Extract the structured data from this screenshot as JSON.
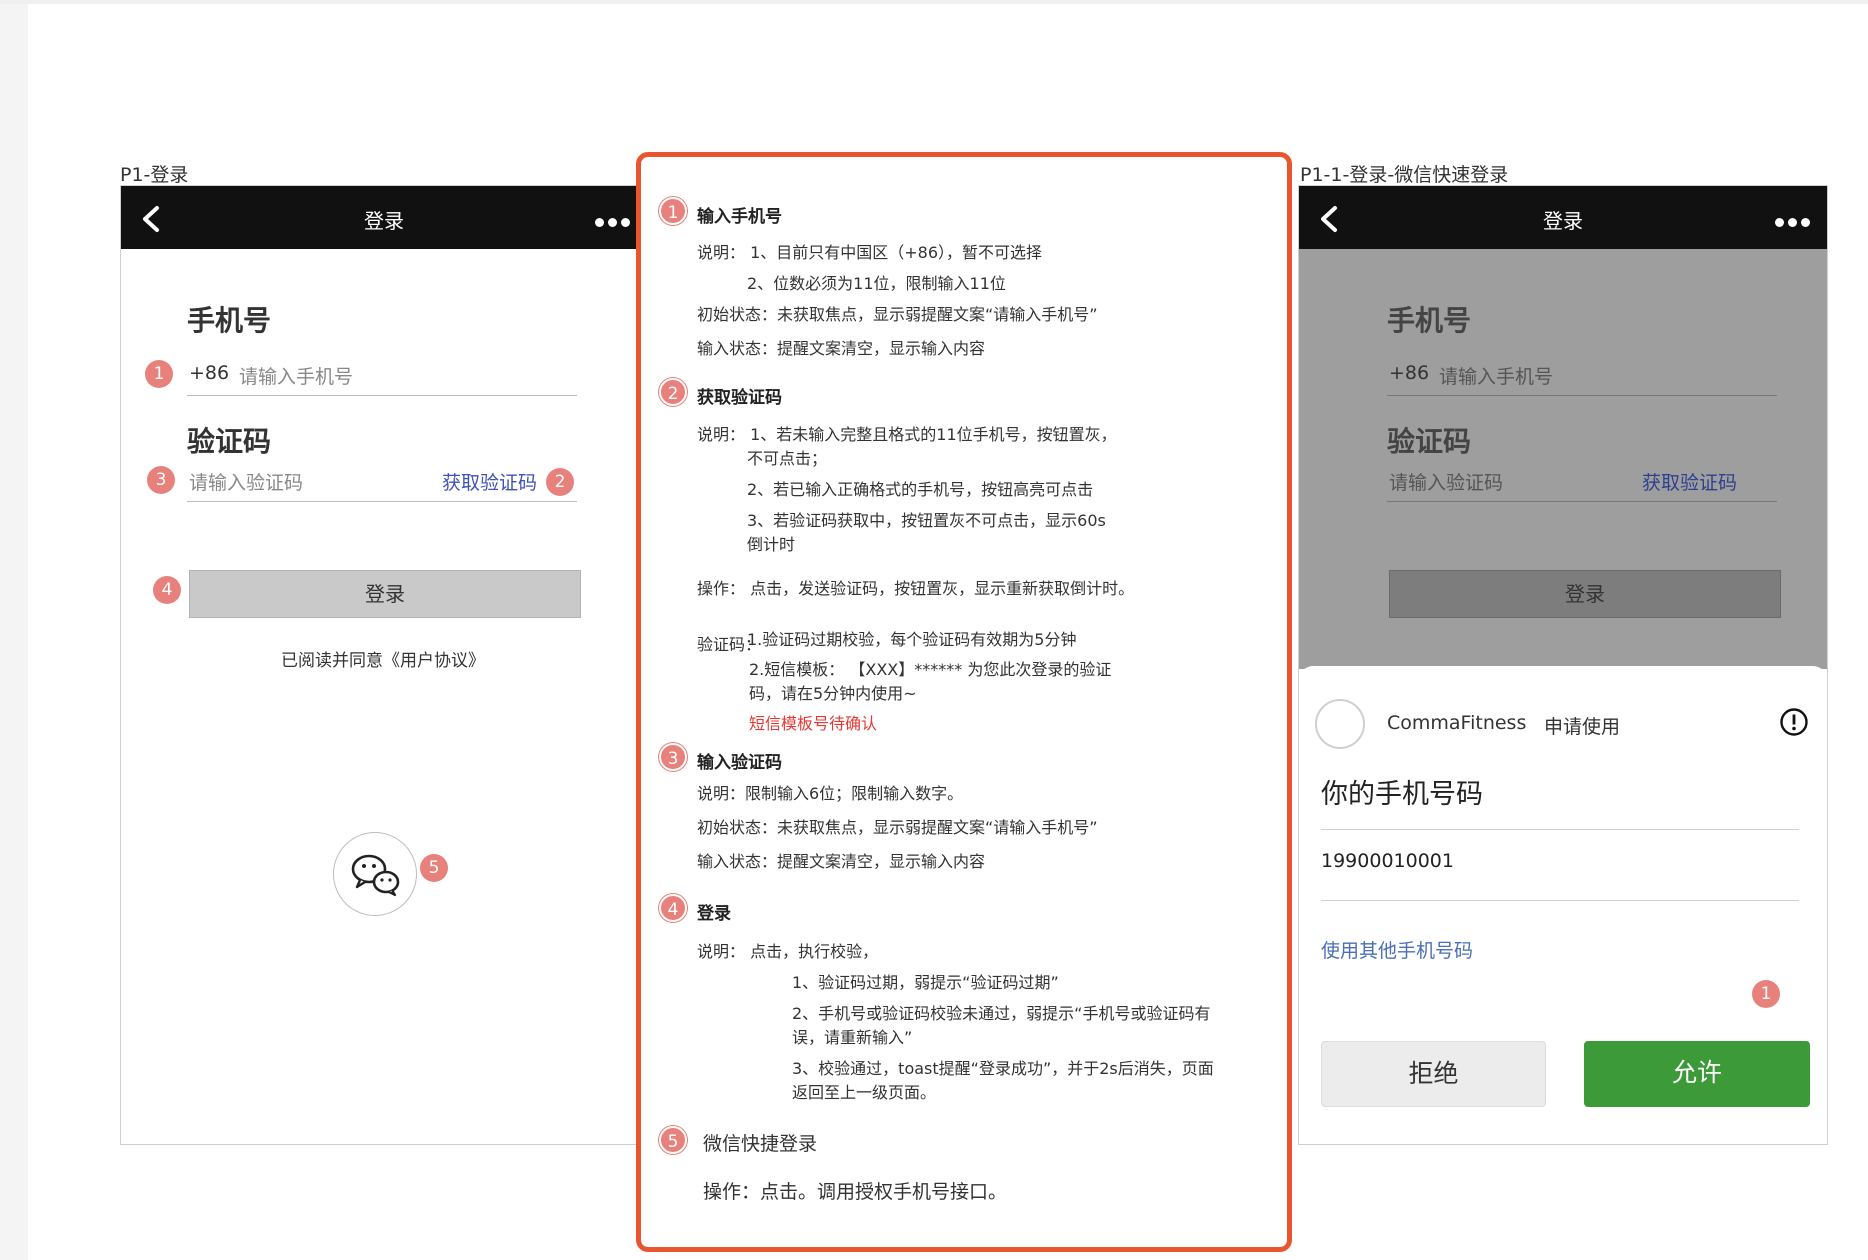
{
  "frames": {
    "left_label": "P1-登录",
    "right_label": "P1-1-登录-微信快速登录"
  },
  "phone1": {
    "nav_title": "登录",
    "phone_title": "手机号",
    "phone_prefix": "+86",
    "phone_placeholder": "请输入手机号",
    "code_title": "验证码",
    "code_placeholder": "请输入验证码",
    "get_code": "获取验证码",
    "login_button": "登录",
    "agreement": "已阅读并同意《用户协议》"
  },
  "badges": [
    "1",
    "2",
    "3",
    "4",
    "5"
  ],
  "spec": {
    "s1_title": "输入手机号",
    "s1_desc1": "说明：  1、目前只有中国区（+86），暂不可选择",
    "s1_desc2": "2、位数必须为11位，限制输入11位",
    "s1_init": "初始状态：未获取焦点，显示弱提醒文案“请输入手机号”",
    "s1_input": "输入状态：提醒文案清空，显示输入内容",
    "s2_title": "获取验证码",
    "s2_desc1a": "说明：  1、若未输入完整且格式的11位手机号，按钮置灰，",
    "s2_desc1b": "不可点击；",
    "s2_desc2": "2、若已输入正确格式的手机号，按钮高亮可点击",
    "s2_desc3a": "3、若验证码获取中，按钮置灰不可点击，显示60s",
    "s2_desc3b": "倒计时",
    "s2_op": "操作：  点击，发送验证码，按钮置灰，显示重新获取倒计时。",
    "s2_code_label": "验证码：",
    "s2_code1": "1.验证码过期校验，每个验证码有效期为5分钟",
    "s2_code2a": "2.短信模板：  【XXX】****** 为您此次登录的验证",
    "s2_code2b": "码，请在5分钟内使用~",
    "s2_pending": "短信模板号待确认",
    "s3_title": "输入验证码",
    "s3_desc": "说明：限制输入6位；限制输入数字。",
    "s3_init": "初始状态：未获取焦点，显示弱提醒文案“请输入手机号”",
    "s3_input": "输入状态：提醒文案清空，显示输入内容",
    "s4_title": "登录",
    "s4_desc": "说明：  点击，执行校验，",
    "s4_r1": "1、验证码过期，弱提示“验证码过期”",
    "s4_r2a": "2、手机号或验证码校验未通过，弱提示“手机号或验证码有",
    "s4_r2b": "误，请重新输入”",
    "s4_r3a": "3、校验通过，toast提醒“登录成功”，并于2s后消失，页面",
    "s4_r3b": "返回至上一级页面。",
    "s5_title": "微信快捷登录",
    "s5_op": "操作：点击。调用授权手机号接口。"
  },
  "phone2": {
    "nav_title": "登录",
    "phone_title": "手机号",
    "phone_prefix": "+86",
    "phone_placeholder": "请输入手机号",
    "code_title": "验证码",
    "code_placeholder": "请输入验证码",
    "get_code": "获取验证码",
    "login_button": "登录",
    "app_name": "CommaFitness",
    "request": "申请使用",
    "sheet_title": "你的手机号码",
    "phone_number": "19900010001",
    "other_phone": "使用其他手机号码",
    "refuse": "拒绝",
    "allow": "允许",
    "badge": "1"
  },
  "colors": {
    "badge": "#e8817b",
    "spec_border": "#e8552f",
    "link": "#3f51b5",
    "allow_green": "#3d9a38",
    "pending_red": "#e53935"
  }
}
